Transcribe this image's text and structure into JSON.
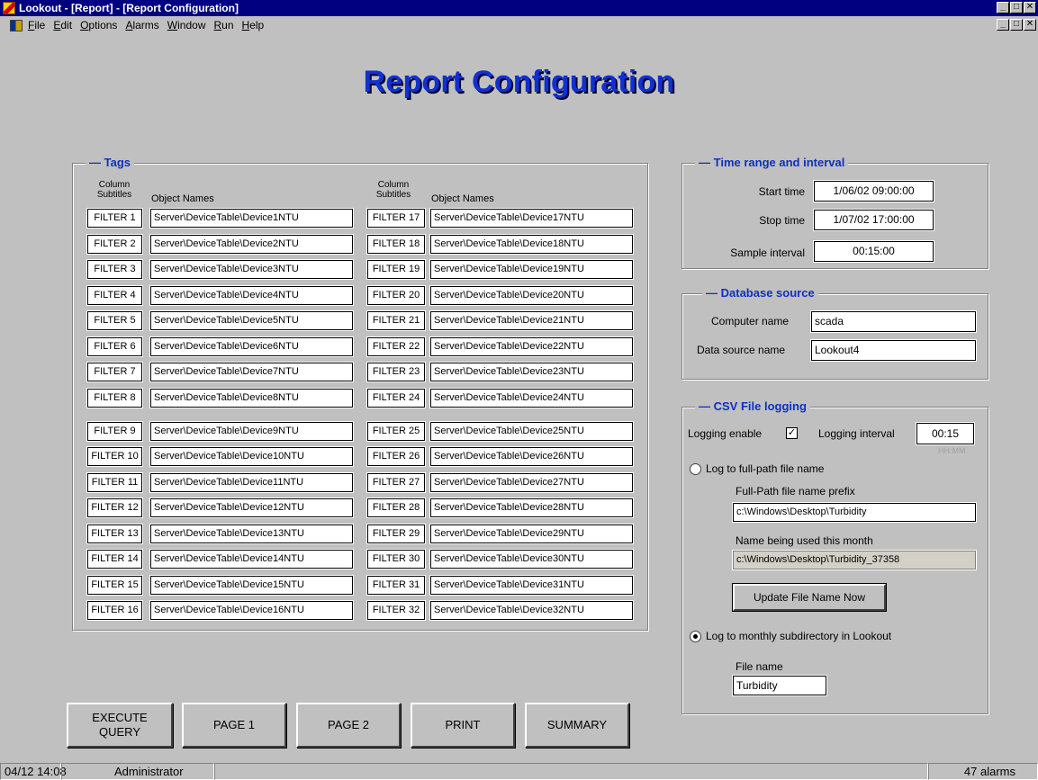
{
  "window": {
    "title": "Lookout - [Report] - [Report Configuration]"
  },
  "menu": [
    {
      "label": "File",
      "ul": "F",
      "rest": "ile"
    },
    {
      "label": "Edit",
      "ul": "E",
      "rest": "dit"
    },
    {
      "label": "Options",
      "ul": "O",
      "rest": "ptions"
    },
    {
      "label": "Alarms",
      "ul": "A",
      "rest": "larms"
    },
    {
      "label": "Window",
      "ul": "W",
      "rest": "indow"
    },
    {
      "label": "Run",
      "ul": "R",
      "rest": "un"
    },
    {
      "label": "Help",
      "ul": "H",
      "rest": "elp"
    }
  ],
  "page_title": "Report Configuration",
  "tags": {
    "label": "Tags",
    "col_subtitles_line1": "Column",
    "col_subtitles_line2": "Subtitles",
    "object_names_label": "Object Names",
    "left": [
      {
        "subtitle": "FILTER 1",
        "object": "Server\\DeviceTable\\Device1NTU"
      },
      {
        "subtitle": "FILTER 2",
        "object": "Server\\DeviceTable\\Device2NTU"
      },
      {
        "subtitle": "FILTER 3",
        "object": "Server\\DeviceTable\\Device3NTU"
      },
      {
        "subtitle": "FILTER 4",
        "object": "Server\\DeviceTable\\Device4NTU"
      },
      {
        "subtitle": "FILTER 5",
        "object": "Server\\DeviceTable\\Device5NTU"
      },
      {
        "subtitle": "FILTER 6",
        "object": "Server\\DeviceTable\\Device6NTU"
      },
      {
        "subtitle": "FILTER 7",
        "object": "Server\\DeviceTable\\Device7NTU"
      },
      {
        "subtitle": "FILTER 8",
        "object": "Server\\DeviceTable\\Device8NTU"
      },
      {
        "subtitle": "FILTER 9",
        "object": "Server\\DeviceTable\\Device9NTU"
      },
      {
        "subtitle": "FILTER 10",
        "object": "Server\\DeviceTable\\Device10NTU"
      },
      {
        "subtitle": "FILTER 11",
        "object": "Server\\DeviceTable\\Device11NTU"
      },
      {
        "subtitle": "FILTER 12",
        "object": "Server\\DeviceTable\\Device12NTU"
      },
      {
        "subtitle": "FILTER 13",
        "object": "Server\\DeviceTable\\Device13NTU"
      },
      {
        "subtitle": "FILTER 14",
        "object": "Server\\DeviceTable\\Device14NTU"
      },
      {
        "subtitle": "FILTER 15",
        "object": "Server\\DeviceTable\\Device15NTU"
      },
      {
        "subtitle": "FILTER 16",
        "object": "Server\\DeviceTable\\Device16NTU"
      }
    ],
    "right": [
      {
        "subtitle": "FILTER 17",
        "object": "Server\\DeviceTable\\Device17NTU"
      },
      {
        "subtitle": "FILTER 18",
        "object": "Server\\DeviceTable\\Device18NTU"
      },
      {
        "subtitle": "FILTER 19",
        "object": "Server\\DeviceTable\\Device19NTU"
      },
      {
        "subtitle": "FILTER 20",
        "object": "Server\\DeviceTable\\Device20NTU"
      },
      {
        "subtitle": "FILTER 21",
        "object": "Server\\DeviceTable\\Device21NTU"
      },
      {
        "subtitle": "FILTER 22",
        "object": "Server\\DeviceTable\\Device22NTU"
      },
      {
        "subtitle": "FILTER 23",
        "object": "Server\\DeviceTable\\Device23NTU"
      },
      {
        "subtitle": "FILTER 24",
        "object": "Server\\DeviceTable\\Device24NTU"
      },
      {
        "subtitle": "FILTER 25",
        "object": "Server\\DeviceTable\\Device25NTU"
      },
      {
        "subtitle": "FILTER 26",
        "object": "Server\\DeviceTable\\Device26NTU"
      },
      {
        "subtitle": "FILTER 27",
        "object": "Server\\DeviceTable\\Device27NTU"
      },
      {
        "subtitle": "FILTER 28",
        "object": "Server\\DeviceTable\\Device28NTU"
      },
      {
        "subtitle": "FILTER 29",
        "object": "Server\\DeviceTable\\Device29NTU"
      },
      {
        "subtitle": "FILTER 30",
        "object": "Server\\DeviceTable\\Device30NTU"
      },
      {
        "subtitle": "FILTER 31",
        "object": "Server\\DeviceTable\\Device31NTU"
      },
      {
        "subtitle": "FILTER 32",
        "object": "Server\\DeviceTable\\Device32NTU"
      }
    ]
  },
  "time_range": {
    "label": "Time range and interval",
    "start_label": "Start time",
    "start_value": "1/06/02 09:00:00",
    "stop_label": "Stop time",
    "stop_value": "1/07/02 17:00:00",
    "interval_label": "Sample interval",
    "interval_value": "00:15:00"
  },
  "database": {
    "label": "Database source",
    "computer_label": "Computer name",
    "computer_value": "scada",
    "dsn_label": "Data source name",
    "dsn_value": "Lookout4"
  },
  "csv": {
    "label": "CSV File logging",
    "enable_label": "Logging enable",
    "enable_checked": true,
    "check_mark": "✓",
    "interval_label": "Logging interval",
    "interval_value": "00:15",
    "interval_hint": "HH:MM",
    "opt_fullpath_label": "Log to full-path file name",
    "opt_fullpath_selected": false,
    "prefix_label": "Full-Path file name prefix",
    "prefix_value": "c:\\Windows\\Desktop\\Turbidity",
    "current_label": "Name being used this month",
    "current_value": "c:\\Windows\\Desktop\\Turbidity_37358",
    "update_button": "Update File Name Now",
    "opt_monthly_label": "Log to monthly subdirectory in Lookout",
    "opt_monthly_selected": true,
    "filename_label": "File name",
    "filename_value": "Turbidity"
  },
  "buttons": {
    "execute_line1": "EXECUTE",
    "execute_line2": "QUERY",
    "page1": "PAGE 1",
    "page2": "PAGE 2",
    "print": "PRINT",
    "summary": "SUMMARY"
  },
  "status": {
    "datetime": "04/12 14:08",
    "user": "Administrator",
    "alarms": "47 alarms"
  }
}
